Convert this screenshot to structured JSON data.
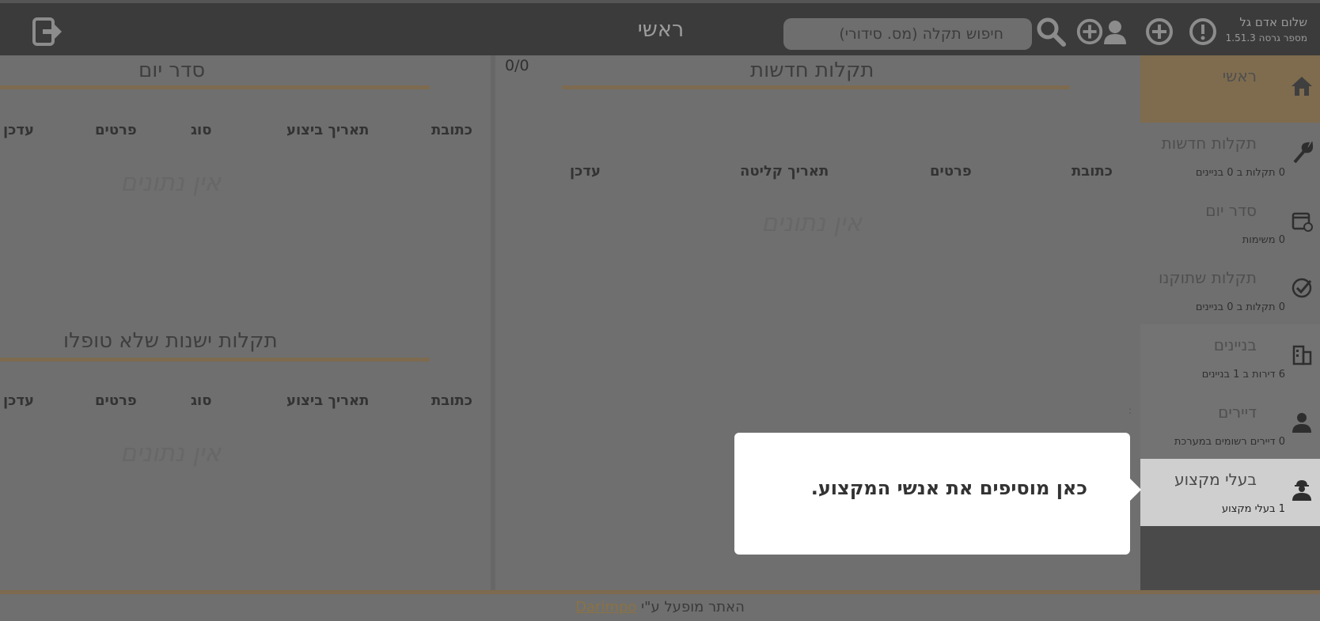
{
  "header": {
    "page_title": "ראשי",
    "search_placeholder": "חיפוש תקלה (מס. סידורי)",
    "user_name": "שלום אדם גל",
    "version": "מספר גרסה 1.51.3"
  },
  "sidebar": {
    "items": [
      {
        "label": "ראשי",
        "sub": "",
        "icon": "home-icon"
      },
      {
        "label": "תקלות חדשות",
        "sub": "0 תקלות ב 0 בניינים",
        "icon": "wrench-icon"
      },
      {
        "label": "סדר יום",
        "sub": "0 משימות",
        "icon": "calendar-icon"
      },
      {
        "label": "תקלות שתוקנו",
        "sub": "0 תקלות ב 0 בניינים",
        "icon": "check-icon"
      },
      {
        "label": "בניינים",
        "sub": "6 דירות ב 1 בניינים",
        "icon": "building-icon"
      },
      {
        "label": "דיירים",
        "sub": "0 דיירים רשומים במערכת",
        "icon": "person-icon"
      },
      {
        "label": "בעלי מקצוע",
        "sub": "1 בעלי מקצוע",
        "icon": "worker-icon"
      }
    ]
  },
  "new_faults": {
    "title": "תקלות חדשות",
    "counter": "0/0",
    "columns": [
      "כתובת",
      "פרטים",
      "תאריך קליטה",
      "עדכן"
    ],
    "empty": "אין נתונים"
  },
  "agenda": {
    "title": "סדר יום",
    "columns": [
      "כתובת",
      "תאריך ביצוע",
      "סוג",
      "פרטים",
      "עדכן"
    ],
    "empty": "אין נתונים"
  },
  "old_faults": {
    "title": "תקלות ישנות שלא טופלו",
    "columns": [
      "כתובת",
      "תאריך ביצוע",
      "סוג",
      "פרטים",
      "עדכן"
    ],
    "empty": "אין נתונים"
  },
  "tooltip": {
    "text": "כאן מוסיפים את אנשי המקצוע."
  },
  "footer": {
    "prefix": "האתר מופעל ע\"י",
    "link": "Darimpo"
  },
  "colors": {
    "accent": "#7d6a4f",
    "overlay": "#6f6f6f",
    "header": "#3b3b3b"
  }
}
